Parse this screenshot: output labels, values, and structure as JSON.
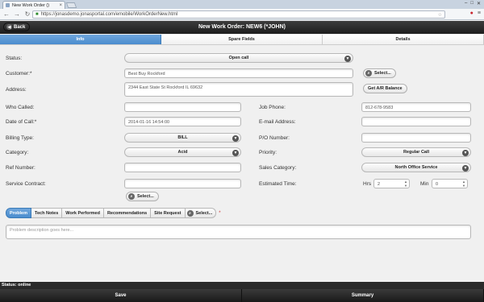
{
  "browser": {
    "tab_title": "New Work Order ()",
    "url": "https://jonasdemo.jonasportal.com/emobile/WorkOrderNew.html",
    "close_glyph": "×"
  },
  "header": {
    "back_label": "Back",
    "title": "New Work Order: NEW6   (*JOHN)"
  },
  "nav_tabs": [
    "Info",
    "Spare Fields",
    "Details"
  ],
  "form": {
    "status": {
      "label": "Status:",
      "value": "Open call"
    },
    "customer": {
      "label": "Customer:*",
      "value": "Best Buy Rockford"
    },
    "customer_select": "Select...",
    "address": {
      "label": "Address:",
      "value": "2344 East State St Rockford IL 69632"
    },
    "ar_balance": "Get A/R Balance",
    "who_called": {
      "label": "Who Called:",
      "value": ""
    },
    "job_phone": {
      "label": "Job Phone:",
      "value": "812-678-9583"
    },
    "date_of_call": {
      "label": "Date of Call:*",
      "value": "2014-01-16 14:54:00"
    },
    "email": {
      "label": "E-mail Address:",
      "value": ""
    },
    "billing_type": {
      "label": "Billing Type:",
      "value": "BILL"
    },
    "po_number": {
      "label": "P/O Number:",
      "value": ""
    },
    "category": {
      "label": "Category:",
      "value": "Acid"
    },
    "priority": {
      "label": "Priority:",
      "value": "Regular Call"
    },
    "ref_number": {
      "label": "Ref Number:",
      "value": ""
    },
    "sales_category": {
      "label": "Sales Category:",
      "value": "North Office Service"
    },
    "service_contract": {
      "label": "Service Contract:",
      "value": ""
    },
    "contract_select": "Select...",
    "estimated_time": {
      "label": "Estimated Time:",
      "hrs_label": "Hrs",
      "hrs_value": "2",
      "min_label": "Min",
      "min_value": "0"
    }
  },
  "sub_tabs": [
    "Problem",
    "Tech Notes",
    "Work Performed",
    "Recommendations",
    "Site Request"
  ],
  "sub_select": "Select...",
  "required_mark": "*",
  "problem_placeholder": "Problem description goes here...",
  "status_bar": "Status: online",
  "footer": {
    "save": "Save",
    "summary": "Summary"
  },
  "icons": {
    "dropdown": "chevron-down-icon",
    "search": "search-icon",
    "back": "back-arrow-icon"
  }
}
